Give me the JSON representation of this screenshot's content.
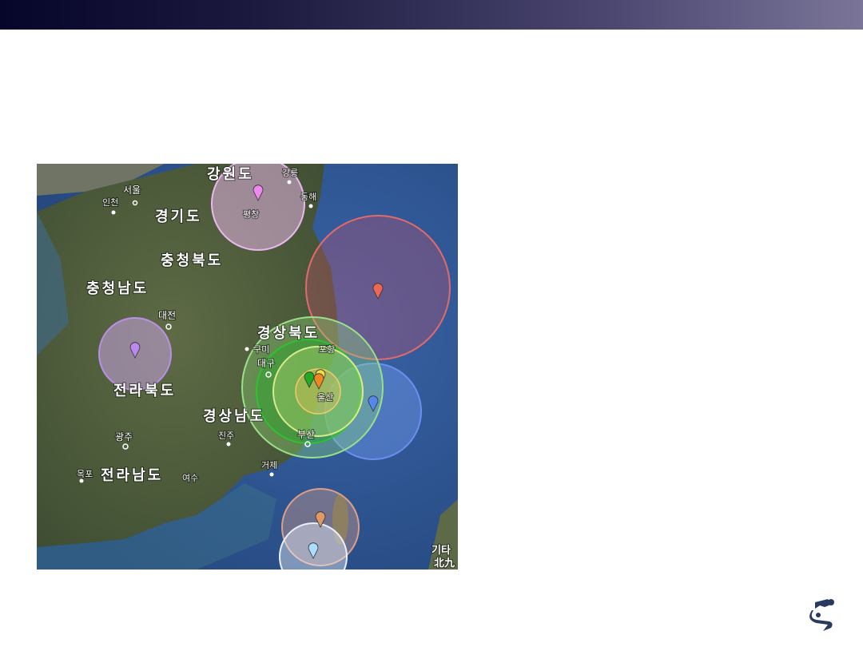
{
  "map": {
    "provinces": [
      {
        "id": "gangwon",
        "label": "강원도"
      },
      {
        "id": "gyeonggi",
        "label": "경기도"
      },
      {
        "id": "chungbuk",
        "label": "충청북도"
      },
      {
        "id": "chungnam",
        "label": "충청남도"
      },
      {
        "id": "gyeongbuk",
        "label": "경상북도"
      },
      {
        "id": "jeonbuk",
        "label": "전라북도"
      },
      {
        "id": "gyeongnam",
        "label": "경상남도"
      },
      {
        "id": "jeonnam",
        "label": "전라남도"
      }
    ],
    "cities": {
      "gangneung": "강릉",
      "seoul": "서울",
      "incheon": "인천",
      "donghae": "동해",
      "pyeongchang": "평창",
      "daejeon": "대전",
      "gumi": "구미",
      "pohang": "포항",
      "daegu": "대구",
      "ulsan": "울산",
      "busan": "부산",
      "gwangju": "광주",
      "jinju": "진주",
      "geoje": "거제",
      "mokpo": "목포",
      "yeosu": "여수"
    },
    "credit": {
      "line1": "기타",
      "line2": "北九"
    },
    "markers": [
      {
        "name": "pink",
        "color": "#ee88ee"
      },
      {
        "name": "red",
        "color": "#ee6655"
      },
      {
        "name": "purple",
        "color": "#bb88ee"
      },
      {
        "name": "blue",
        "color": "#5588ee"
      },
      {
        "name": "green",
        "color": "#22aa22"
      },
      {
        "name": "yellow",
        "color": "#eedd44"
      },
      {
        "name": "orange",
        "color": "#ee8822"
      },
      {
        "name": "tan",
        "color": "#dd9966"
      },
      {
        "name": "light-blue",
        "color": "#aaddff"
      }
    ]
  },
  "logo": {
    "icon": "robot-arm-logo-icon"
  }
}
